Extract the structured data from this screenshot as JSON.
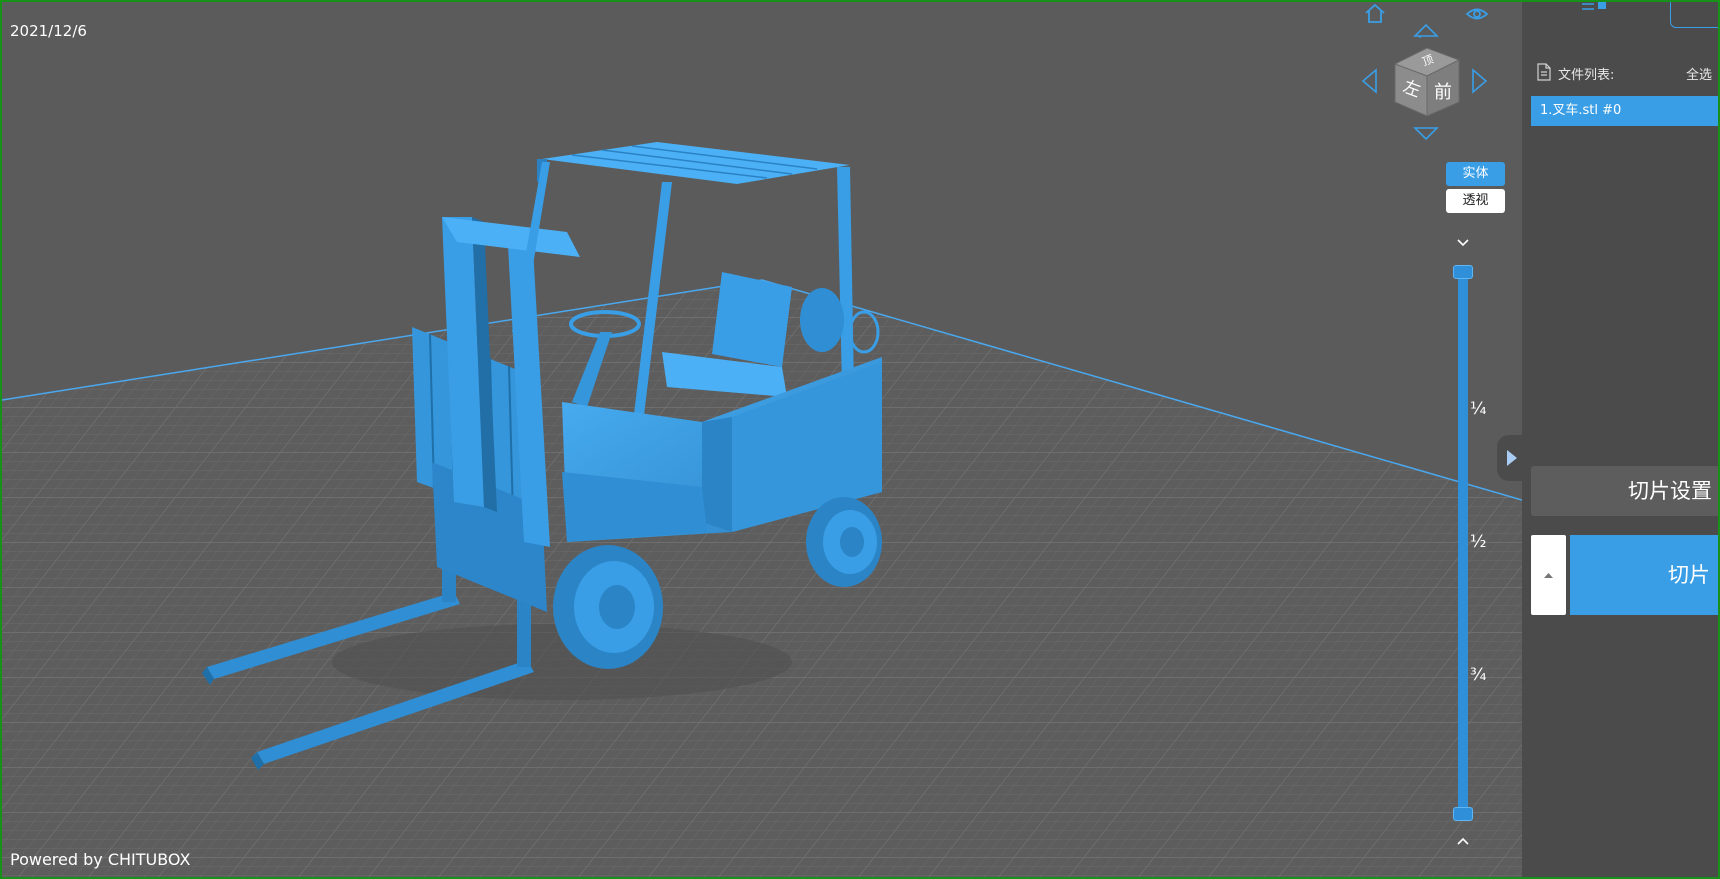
{
  "viewport": {
    "date": "2021/12/6",
    "powered_by": "Powered by CHITUBOX",
    "navcube": {
      "top_label": "顶",
      "left_label": "左",
      "front_label": "前"
    },
    "modes": {
      "solid": "实体",
      "transparent": "透视"
    },
    "slider": {
      "quarter": "¼",
      "half": "½",
      "three_quarter": "¾"
    },
    "model_color": "#3a9ee6",
    "grid_color": "#6a6a6a",
    "plate_edge_color": "#4aa8ef"
  },
  "sidebar": {
    "file_list_label": "文件列表:",
    "select_all": "全选",
    "files": [
      {
        "name": "1.叉车.stl #0"
      }
    ],
    "slice_settings_label": "切片设置",
    "slice_label": "切片"
  }
}
